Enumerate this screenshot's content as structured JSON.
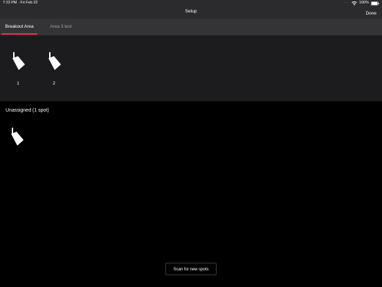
{
  "status_bar": {
    "time_date": "7:23 PM · Fri Feb 22",
    "signal": "····",
    "battery": "100%"
  },
  "nav": {
    "title": "Setup",
    "done_label": "Done"
  },
  "tabs": [
    {
      "label": "Breakout Area",
      "active": true
    },
    {
      "label": "Area 3 test",
      "active": false
    }
  ],
  "assigned_spots": [
    {
      "label": "1",
      "icon": "spotlight-icon"
    },
    {
      "label": "2",
      "icon": "spotlight-icon"
    }
  ],
  "unassigned": {
    "title": "Unassigned (1 spot)",
    "spots": [
      {
        "icon": "spotlight-icon"
      }
    ]
  },
  "scan_button_label": "Scan for new spots",
  "colors": {
    "accent": "#e8324a",
    "bar": "#2b2b2d",
    "tab_bar": "#343436",
    "panel": "#1c1c1e",
    "background": "#000000"
  }
}
